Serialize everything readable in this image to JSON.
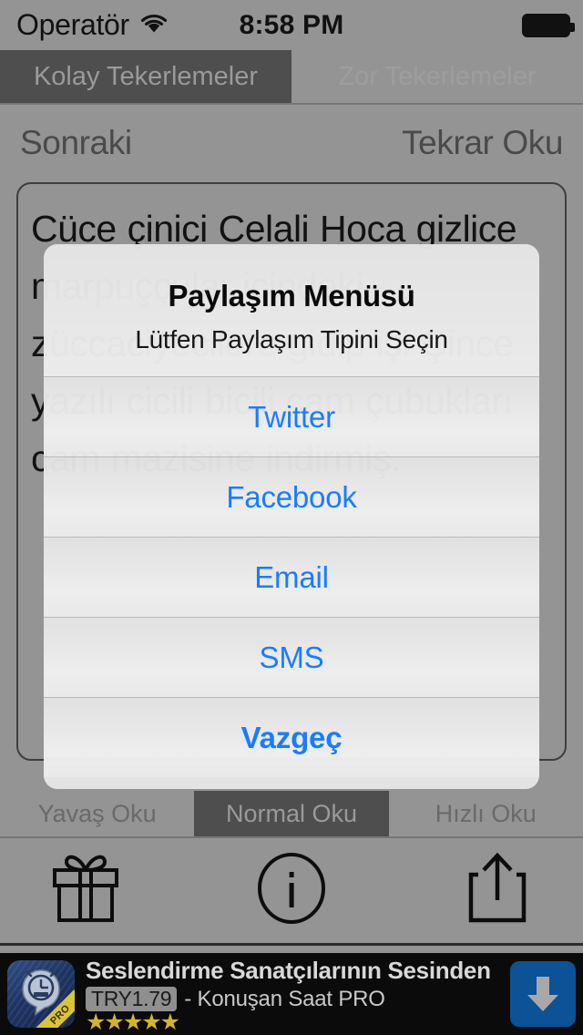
{
  "status_bar": {
    "carrier": "Operatör",
    "wifi_icon": "wifi-icon",
    "time": "8:58 PM",
    "battery_icon": "battery-full-icon"
  },
  "top_tabs": [
    {
      "label": "Kolay Tekerlemeler",
      "selected": true
    },
    {
      "label": "Zor Tekerlemeler",
      "selected": false
    }
  ],
  "nav": {
    "next_label": "Sonraki",
    "repeat_label": "Tekrar Oku"
  },
  "content": {
    "tongue_twister": "Cüce çinici Celali Hoca gizlice marpuççular içindeki züccaciyecilere gidip işi Çince yazılı cicili bicili cam çubukları cam mazisine indirmiş."
  },
  "speed_tabs": [
    {
      "label": "Yavaş Oku",
      "selected": false
    },
    {
      "label": "Normal Oku",
      "selected": true
    },
    {
      "label": "Hızlı Oku",
      "selected": false
    }
  ],
  "toolbar": [
    {
      "icon": "gift-icon",
      "name": "gift-button"
    },
    {
      "icon": "info-circle-icon",
      "name": "info-button"
    },
    {
      "icon": "share-icon",
      "name": "share-button"
    }
  ],
  "dialog": {
    "title": "Paylaşım Menüsü",
    "subtitle": "Lütfen Paylaşım Tipini Seçin",
    "buttons": [
      {
        "label": "Twitter",
        "style": "default"
      },
      {
        "label": "Facebook",
        "style": "default"
      },
      {
        "label": "Email",
        "style": "default"
      },
      {
        "label": "SMS",
        "style": "default"
      },
      {
        "label": "Vazgeç",
        "style": "cancel"
      }
    ]
  },
  "ad": {
    "title": "Seslendirme Sanatçılarının Sesinden",
    "price": "TRY1.79",
    "app_name": "- Konuşan Saat PRO",
    "stars": "★★★★★",
    "rating": 5,
    "badge": "PRO",
    "download_icon": "download-arrow-icon",
    "accent_color": "#0b5396",
    "star_color": "#d6b429"
  }
}
